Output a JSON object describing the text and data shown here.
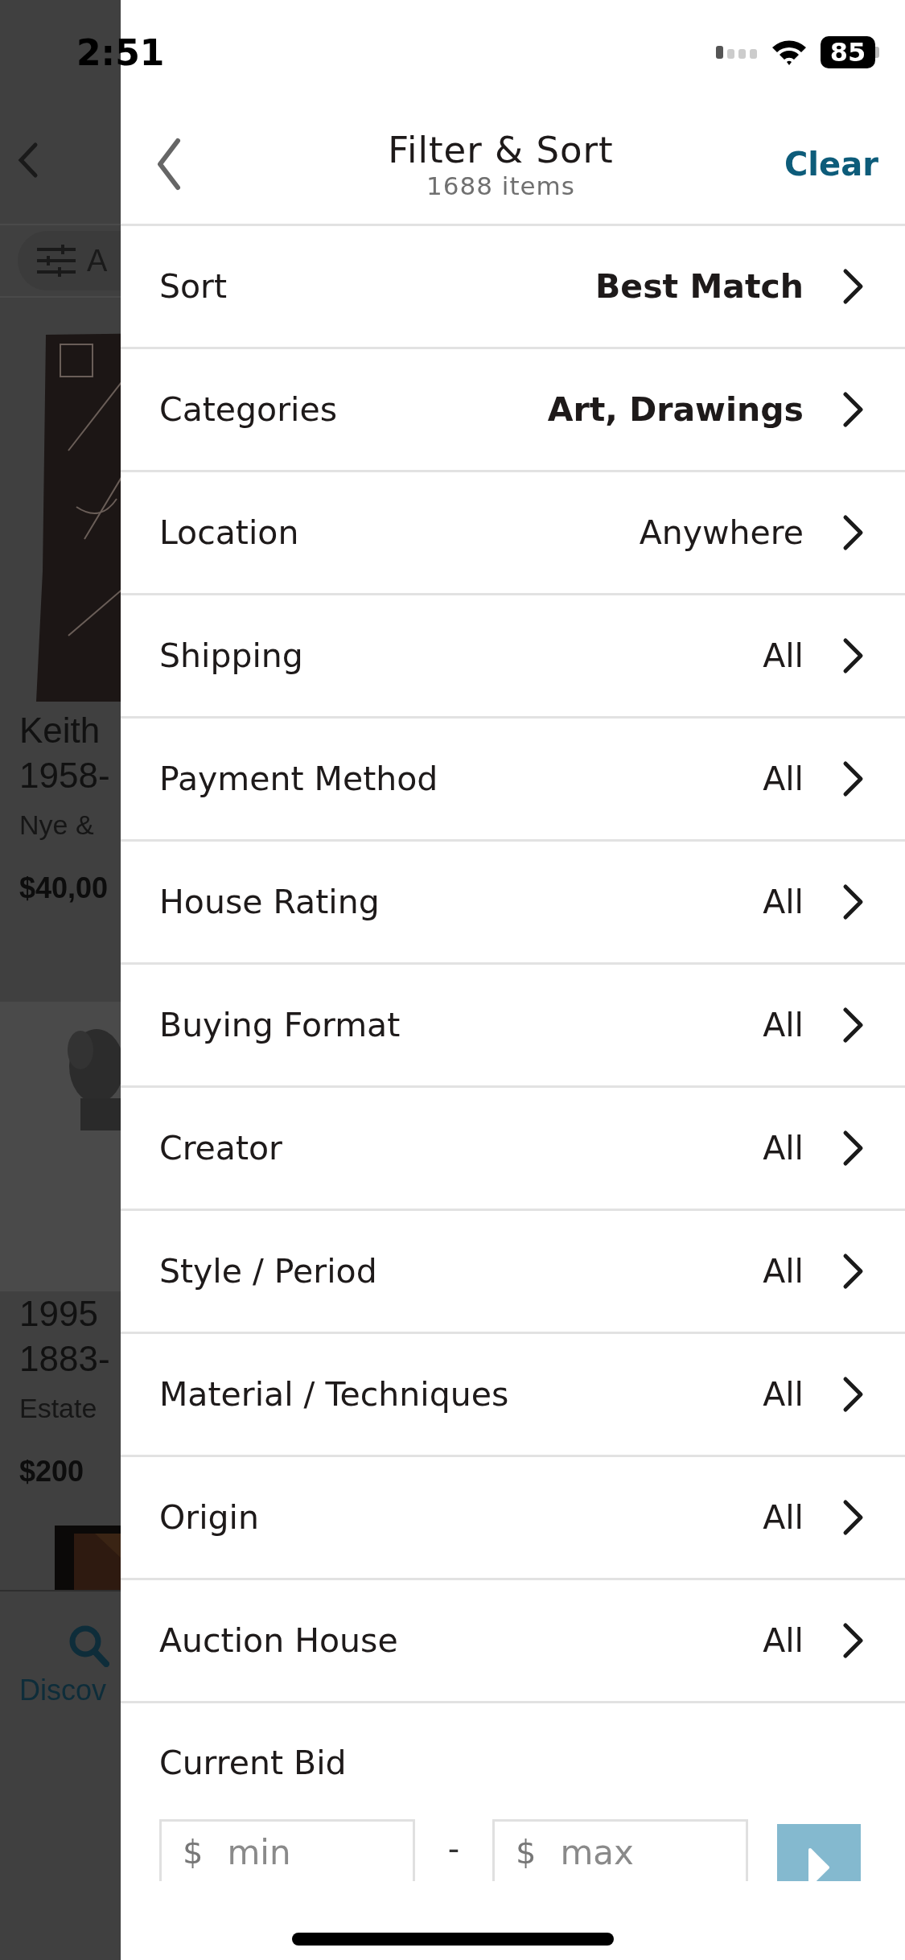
{
  "status_bar": {
    "time": "2:51",
    "battery": "85"
  },
  "background": {
    "filter_chip": "A",
    "items": [
      {
        "title_lines": [
          "Keith",
          "1958-"
        ],
        "house": "Nye &",
        "price": "$40,00"
      },
      {
        "title_lines": [
          "1995",
          "1883-"
        ],
        "house": "Estate",
        "price": "$200"
      }
    ],
    "tab_label": "Discov"
  },
  "header": {
    "title": "Filter & Sort",
    "subtitle": "1688 items",
    "action": "Clear"
  },
  "filters": [
    {
      "label": "Sort",
      "value": "Best Match",
      "applied": true
    },
    {
      "label": "Categories",
      "value": "Art, Drawings",
      "applied": true
    },
    {
      "label": "Location",
      "value": "Anywhere",
      "applied": false
    },
    {
      "label": "Shipping",
      "value": "All",
      "applied": false
    },
    {
      "label": "Payment Method",
      "value": "All",
      "applied": false
    },
    {
      "label": "House Rating",
      "value": "All",
      "applied": false
    },
    {
      "label": "Buying Format",
      "value": "All",
      "applied": false
    },
    {
      "label": "Creator",
      "value": "All",
      "applied": false
    },
    {
      "label": "Style / Period",
      "value": "All",
      "applied": false
    },
    {
      "label": "Material / Techniques",
      "value": "All",
      "applied": false
    },
    {
      "label": "Origin",
      "value": "All",
      "applied": false
    },
    {
      "label": "Auction House",
      "value": "All",
      "applied": false
    }
  ],
  "current_bid": {
    "label": "Current Bid",
    "min": {
      "prefix": "$",
      "placeholder": "min"
    },
    "separator": "-",
    "max": {
      "prefix": "$",
      "placeholder": "max"
    }
  }
}
